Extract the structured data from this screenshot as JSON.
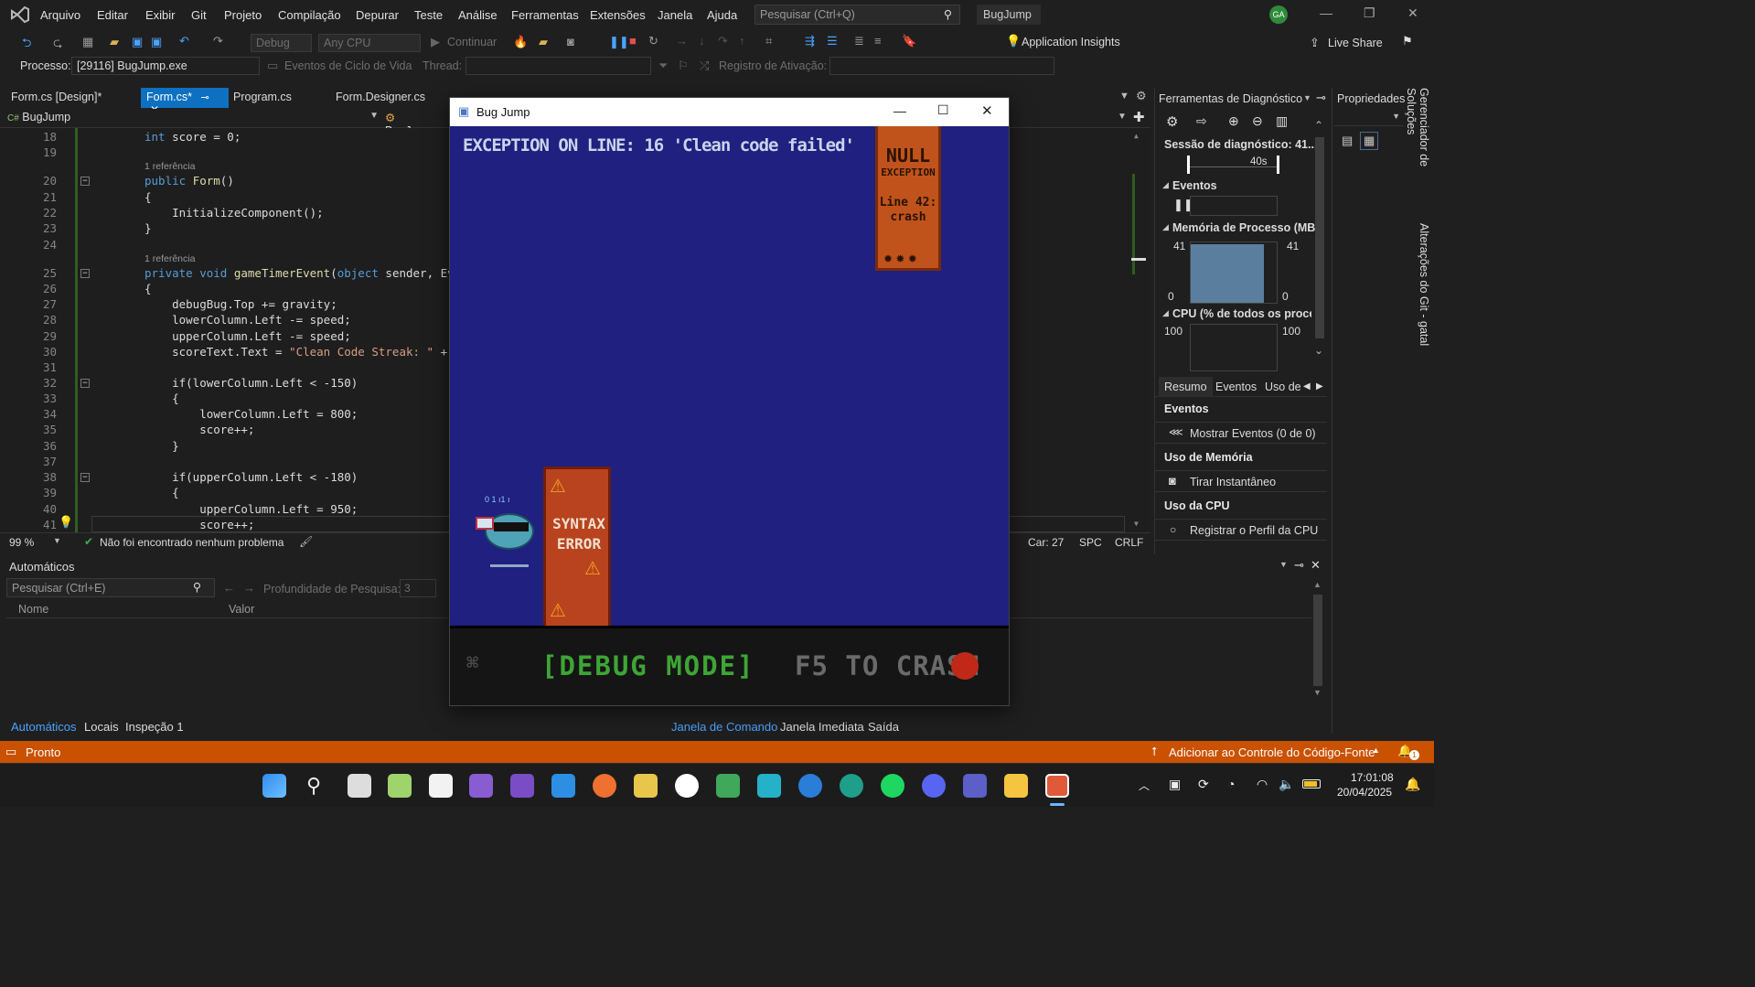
{
  "menu": [
    "Arquivo",
    "Editar",
    "Exibir",
    "Git",
    "Projeto",
    "Compilação",
    "Depurar",
    "Teste",
    "Análise",
    "Ferramentas",
    "Extensões",
    "Janela",
    "Ajuda"
  ],
  "search": {
    "placeholder": "Pesquisar (Ctrl+Q)"
  },
  "solution_name": "BugJump",
  "avatar_initials": "GA",
  "toolbar": {
    "config": "Debug",
    "platform": "Any CPU",
    "continue_label": "Continuar",
    "app_insights": "Application Insights",
    "live_share": "Live Share"
  },
  "debug_bar": {
    "process_label": "Processo:",
    "process_value": "[29116] BugJump.exe",
    "lifecycle": "Eventos de Ciclo de Vida",
    "thread_label": "Thread:",
    "activation_label": "Registro de Ativação:"
  },
  "tabs": [
    {
      "label": "Form.cs [Design]*"
    },
    {
      "label": "Form.cs*",
      "active": true
    },
    {
      "label": "Program.cs"
    },
    {
      "label": "Form.Designer.cs"
    }
  ],
  "navbar": {
    "project": "BugJump",
    "class": "BugJump."
  },
  "code": {
    "ref1": "1 referência",
    "ref2": "1 referência",
    "lines": [
      "18",
      "19",
      "20",
      "21",
      "22",
      "23",
      "24",
      "25",
      "26",
      "27",
      "28",
      "29",
      "30",
      "31",
      "32",
      "33",
      "34",
      "35",
      "36",
      "37",
      "38",
      "39",
      "40",
      "41"
    ],
    "l18a": "int",
    "l18b": " score = 0;",
    "l20a": "public",
    "l20b": "Form",
    "l20c": "()",
    "l21": "{",
    "l22": "    InitializeComponent();",
    "l23": "}",
    "l25a": "private void",
    "l25b": "gameTimerEvent",
    "l25c": "(",
    "l25d": "object",
    "l25e": " sender, Eve",
    "l26": "{",
    "l27": "    debugBug.Top += gravity;",
    "l28": "    lowerColumn.Left -= speed;",
    "l29": "    upperColumn.Left -= speed;",
    "l30a": "    scoreText.Text = ",
    "l30b": "\"Clean Code Streak: \"",
    "l30c": " + s",
    "l32": "    if(lowerColumn.Left < -150)",
    "l33": "    {",
    "l34": "        lowerColumn.Left = 800;",
    "l35": "        score++;",
    "l36": "    }",
    "l38": "    if(upperColumn.Left < -180)",
    "l39": "    {",
    "l40": "        upperColumn.Left = 950;",
    "l41": "        score++;"
  },
  "editor_status": {
    "zoom": "99 %",
    "issues": "Não foi encontrado nenhum problema",
    "car": "Car: 27",
    "spc": "SPC",
    "crlf": "CRLF"
  },
  "autos": {
    "title": "Automáticos",
    "search_placeholder": "Pesquisar (Ctrl+E)",
    "depth_label": "Profundidade de Pesquisa:",
    "depth_value": "3",
    "col_name": "Nome",
    "col_value": "Valor",
    "tabs": [
      "Automáticos",
      "Locais",
      "Inspeção 1"
    ],
    "right_tabs": [
      "Janela de Comando",
      "Janela Imediata",
      "Saída"
    ]
  },
  "diag": {
    "title": "Ferramentas de Diagnóstico",
    "session": "Sessão de diagnóstico: 41...",
    "timeline_label": "40s",
    "events_header": "Eventos",
    "memory_header": "Memória de Processo (MB)",
    "mem_max": "41",
    "mem_min": "0",
    "mem_max_r": "41",
    "mem_min_r": "0",
    "cpu_header": "CPU (% de todos os process",
    "cpu_max": "100",
    "cpu_max_r": "100",
    "subtabs": [
      "Resumo",
      "Eventos",
      "Uso de"
    ],
    "sec_events": "Eventos",
    "show_events": "Mostrar Eventos (0 de 0)",
    "sec_memory": "Uso de Memória",
    "snapshot": "Tirar Instantâneo",
    "sec_cpu": "Uso da CPU",
    "cpu_profile": "Registrar o Perfil da CPU"
  },
  "props": {
    "title": "Propriedades"
  },
  "vtabs": [
    "Gerenciador de Soluções",
    "Alterações do Git - gatal"
  ],
  "status": {
    "ready": "Pronto",
    "source_control": "Adicionar ao Controle do Código-Fonte",
    "notif_count": "1"
  },
  "game": {
    "window_title": "Bug Jump",
    "exception_text": "EXCEPTION ON LINE:  16 'Clean code failed'",
    "top_pillar": {
      "l1": "NULL",
      "l2": "EXCEPTION",
      "l3": "Line 42:",
      "l4": "crash"
    },
    "bottom_pillar": {
      "l1": "SYNTAX",
      "l2": "ERROR"
    },
    "footer_text": "[DEBUG MODE]",
    "footer_text2": "F5 TO CRASH"
  },
  "clock": {
    "time": "17:01:08",
    "date": "20/04/2025"
  },
  "colors": {
    "accent": "#ca5100",
    "game_bg": "#1f2080",
    "pillar": "#c0531b",
    "footer_green": "#3ea535"
  }
}
